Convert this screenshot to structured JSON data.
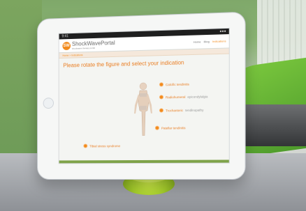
{
  "brand": {
    "name": "ShockWavePortal",
    "tagline": "shockwave therapy portal",
    "mark": "SW"
  },
  "status_bar": {
    "time": "9:41"
  },
  "nav": {
    "items": [
      "Home",
      "Blog",
      "Indications"
    ]
  },
  "breadcrumb": "Home > Indications",
  "page": {
    "title": "Please rotate the figure and select your indication"
  },
  "hotspots": [
    {
      "label": "Calcific tendinitis",
      "sub": ""
    },
    {
      "label": "Radiohumeral",
      "sub": "epicondylalgia"
    },
    {
      "label": "Trochanteric",
      "sub": "tendinopathy"
    },
    {
      "label": "Patellar tendinitis",
      "sub": ""
    },
    {
      "label": "Tibial stress syndrome",
      "sub": ""
    }
  ],
  "colors": {
    "accent": "#F28A1B",
    "footer": "#7FA34A",
    "cup": "#B8DA32"
  }
}
